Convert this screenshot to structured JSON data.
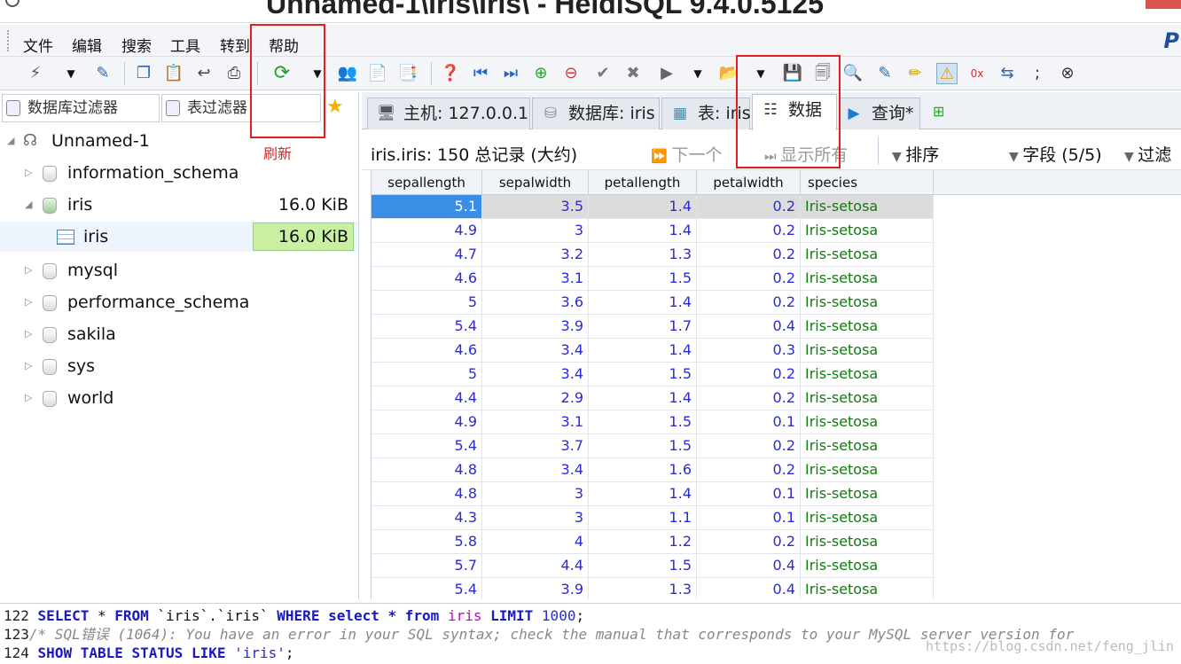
{
  "window": {
    "title": "Unnamed-1\\iris\\iris\\ - HeidiSQL 9.4.0.5125"
  },
  "menu": {
    "items": [
      "文件",
      "编辑",
      "搜索",
      "工具",
      "转到",
      "帮助"
    ]
  },
  "left": {
    "db_filter": "数据库过滤器",
    "table_filter": "表过滤器",
    "tree": [
      {
        "label": "Unnamed-1",
        "size": ""
      },
      {
        "label": "information_schema",
        "size": ""
      },
      {
        "label": "iris",
        "size": "16.0 KiB"
      },
      {
        "label": "iris",
        "size": "16.0 KiB"
      },
      {
        "label": "mysql",
        "size": ""
      },
      {
        "label": "performance_schema",
        "size": ""
      },
      {
        "label": "sakila",
        "size": ""
      },
      {
        "label": "sys",
        "size": ""
      },
      {
        "label": "world",
        "size": ""
      }
    ]
  },
  "tabs": [
    "主机: 127.0.0.1",
    "数据库: iris",
    "表: iris",
    "数据",
    "查询*"
  ],
  "infobar": {
    "records": "iris.iris: 150 总记录 (大约)",
    "next": "下一个",
    "show_all": "显示所有",
    "sort": "排序",
    "fields": "字段 (5/5)",
    "filter": "过滤"
  },
  "grid": {
    "columns": [
      "sepallength",
      "sepalwidth",
      "petallength",
      "petalwidth",
      "species"
    ],
    "rows": [
      [
        "5.1",
        "3.5",
        "1.4",
        "0.2",
        "Iris-setosa"
      ],
      [
        "4.9",
        "3",
        "1.4",
        "0.2",
        "Iris-setosa"
      ],
      [
        "4.7",
        "3.2",
        "1.3",
        "0.2",
        "Iris-setosa"
      ],
      [
        "4.6",
        "3.1",
        "1.5",
        "0.2",
        "Iris-setosa"
      ],
      [
        "5",
        "3.6",
        "1.4",
        "0.2",
        "Iris-setosa"
      ],
      [
        "5.4",
        "3.9",
        "1.7",
        "0.4",
        "Iris-setosa"
      ],
      [
        "4.6",
        "3.4",
        "1.4",
        "0.3",
        "Iris-setosa"
      ],
      [
        "5",
        "3.4",
        "1.5",
        "0.2",
        "Iris-setosa"
      ],
      [
        "4.4",
        "2.9",
        "1.4",
        "0.2",
        "Iris-setosa"
      ],
      [
        "4.9",
        "3.1",
        "1.5",
        "0.1",
        "Iris-setosa"
      ],
      [
        "5.4",
        "3.7",
        "1.5",
        "0.2",
        "Iris-setosa"
      ],
      [
        "4.8",
        "3.4",
        "1.6",
        "0.2",
        "Iris-setosa"
      ],
      [
        "4.8",
        "3",
        "1.4",
        "0.1",
        "Iris-setosa"
      ],
      [
        "4.3",
        "3",
        "1.1",
        "0.1",
        "Iris-setosa"
      ],
      [
        "5.8",
        "4",
        "1.2",
        "0.2",
        "Iris-setosa"
      ],
      [
        "5.7",
        "4.4",
        "1.5",
        "0.4",
        "Iris-setosa"
      ],
      [
        "5.4",
        "3.9",
        "1.3",
        "0.4",
        "Iris-setosa"
      ]
    ]
  },
  "sql_log": {
    "l122": {
      "n": "122",
      "a": "SELECT",
      "b": " * ",
      "c": "FROM",
      "d": " `iris`.`iris` ",
      "e": "WHERE",
      "f": " select * from ",
      "g": "iris",
      "h": " LIMIT ",
      "i": "1000",
      "j": ";"
    },
    "l123": {
      "n": "123",
      "text": "/* SQL错误 (1064): You have an error in your SQL syntax; check the manual that corresponds to your MySQL server version for"
    },
    "l124": {
      "n": "124",
      "a": "SHOW TABLE STATUS LIKE",
      "b": " 'iris'",
      "c": ";"
    }
  },
  "annotation": {
    "refresh": "刷新"
  },
  "watermark": "https://blog.csdn.net/feng_jlin"
}
